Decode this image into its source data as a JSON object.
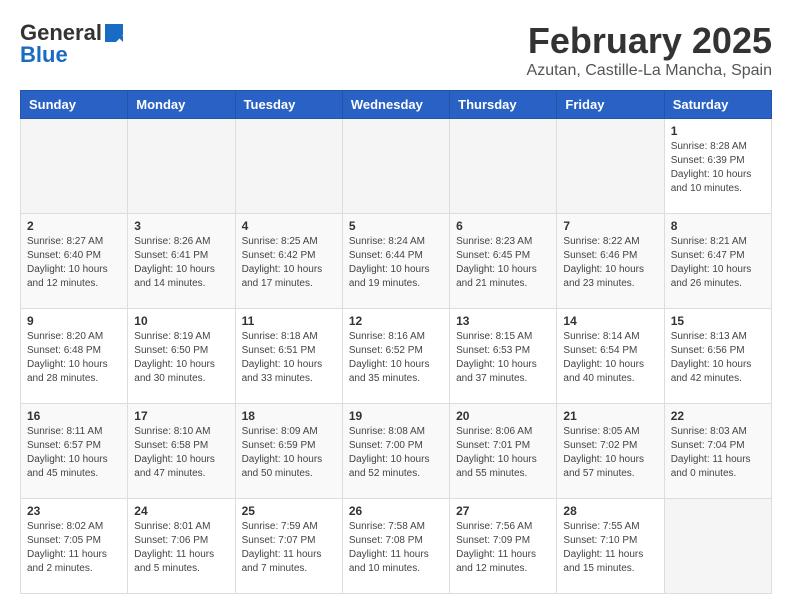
{
  "logo": {
    "general": "General",
    "blue": "Blue"
  },
  "title": {
    "month": "February 2025",
    "location": "Azutan, Castille-La Mancha, Spain"
  },
  "weekdays": [
    "Sunday",
    "Monday",
    "Tuesday",
    "Wednesday",
    "Thursday",
    "Friday",
    "Saturday"
  ],
  "weeks": [
    [
      {
        "day": "",
        "info": ""
      },
      {
        "day": "",
        "info": ""
      },
      {
        "day": "",
        "info": ""
      },
      {
        "day": "",
        "info": ""
      },
      {
        "day": "",
        "info": ""
      },
      {
        "day": "",
        "info": ""
      },
      {
        "day": "1",
        "info": "Sunrise: 8:28 AM\nSunset: 6:39 PM\nDaylight: 10 hours and 10 minutes."
      }
    ],
    [
      {
        "day": "2",
        "info": "Sunrise: 8:27 AM\nSunset: 6:40 PM\nDaylight: 10 hours and 12 minutes."
      },
      {
        "day": "3",
        "info": "Sunrise: 8:26 AM\nSunset: 6:41 PM\nDaylight: 10 hours and 14 minutes."
      },
      {
        "day": "4",
        "info": "Sunrise: 8:25 AM\nSunset: 6:42 PM\nDaylight: 10 hours and 17 minutes."
      },
      {
        "day": "5",
        "info": "Sunrise: 8:24 AM\nSunset: 6:44 PM\nDaylight: 10 hours and 19 minutes."
      },
      {
        "day": "6",
        "info": "Sunrise: 8:23 AM\nSunset: 6:45 PM\nDaylight: 10 hours and 21 minutes."
      },
      {
        "day": "7",
        "info": "Sunrise: 8:22 AM\nSunset: 6:46 PM\nDaylight: 10 hours and 23 minutes."
      },
      {
        "day": "8",
        "info": "Sunrise: 8:21 AM\nSunset: 6:47 PM\nDaylight: 10 hours and 26 minutes."
      }
    ],
    [
      {
        "day": "9",
        "info": "Sunrise: 8:20 AM\nSunset: 6:48 PM\nDaylight: 10 hours and 28 minutes."
      },
      {
        "day": "10",
        "info": "Sunrise: 8:19 AM\nSunset: 6:50 PM\nDaylight: 10 hours and 30 minutes."
      },
      {
        "day": "11",
        "info": "Sunrise: 8:18 AM\nSunset: 6:51 PM\nDaylight: 10 hours and 33 minutes."
      },
      {
        "day": "12",
        "info": "Sunrise: 8:16 AM\nSunset: 6:52 PM\nDaylight: 10 hours and 35 minutes."
      },
      {
        "day": "13",
        "info": "Sunrise: 8:15 AM\nSunset: 6:53 PM\nDaylight: 10 hours and 37 minutes."
      },
      {
        "day": "14",
        "info": "Sunrise: 8:14 AM\nSunset: 6:54 PM\nDaylight: 10 hours and 40 minutes."
      },
      {
        "day": "15",
        "info": "Sunrise: 8:13 AM\nSunset: 6:56 PM\nDaylight: 10 hours and 42 minutes."
      }
    ],
    [
      {
        "day": "16",
        "info": "Sunrise: 8:11 AM\nSunset: 6:57 PM\nDaylight: 10 hours and 45 minutes."
      },
      {
        "day": "17",
        "info": "Sunrise: 8:10 AM\nSunset: 6:58 PM\nDaylight: 10 hours and 47 minutes."
      },
      {
        "day": "18",
        "info": "Sunrise: 8:09 AM\nSunset: 6:59 PM\nDaylight: 10 hours and 50 minutes."
      },
      {
        "day": "19",
        "info": "Sunrise: 8:08 AM\nSunset: 7:00 PM\nDaylight: 10 hours and 52 minutes."
      },
      {
        "day": "20",
        "info": "Sunrise: 8:06 AM\nSunset: 7:01 PM\nDaylight: 10 hours and 55 minutes."
      },
      {
        "day": "21",
        "info": "Sunrise: 8:05 AM\nSunset: 7:02 PM\nDaylight: 10 hours and 57 minutes."
      },
      {
        "day": "22",
        "info": "Sunrise: 8:03 AM\nSunset: 7:04 PM\nDaylight: 11 hours and 0 minutes."
      }
    ],
    [
      {
        "day": "23",
        "info": "Sunrise: 8:02 AM\nSunset: 7:05 PM\nDaylight: 11 hours and 2 minutes."
      },
      {
        "day": "24",
        "info": "Sunrise: 8:01 AM\nSunset: 7:06 PM\nDaylight: 11 hours and 5 minutes."
      },
      {
        "day": "25",
        "info": "Sunrise: 7:59 AM\nSunset: 7:07 PM\nDaylight: 11 hours and 7 minutes."
      },
      {
        "day": "26",
        "info": "Sunrise: 7:58 AM\nSunset: 7:08 PM\nDaylight: 11 hours and 10 minutes."
      },
      {
        "day": "27",
        "info": "Sunrise: 7:56 AM\nSunset: 7:09 PM\nDaylight: 11 hours and 12 minutes."
      },
      {
        "day": "28",
        "info": "Sunrise: 7:55 AM\nSunset: 7:10 PM\nDaylight: 11 hours and 15 minutes."
      },
      {
        "day": "",
        "info": ""
      }
    ]
  ]
}
